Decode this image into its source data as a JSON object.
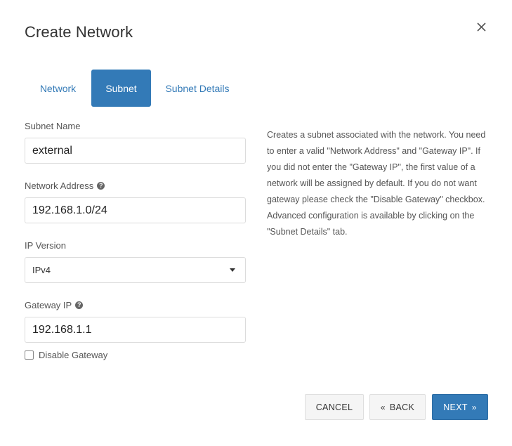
{
  "dialog": {
    "title": "Create Network"
  },
  "tabs": [
    {
      "label": "Network",
      "active": false
    },
    {
      "label": "Subnet",
      "active": true
    },
    {
      "label": "Subnet Details",
      "active": false
    }
  ],
  "form": {
    "subnet_name": {
      "label": "Subnet Name",
      "value": "external"
    },
    "network_address": {
      "label": "Network Address",
      "value": "192.168.1.0/24",
      "help": "?"
    },
    "ip_version": {
      "label": "IP Version",
      "selected": "IPv4"
    },
    "gateway_ip": {
      "label": "Gateway IP",
      "value": "192.168.1.1",
      "help": "?"
    },
    "disable_gateway": {
      "label": "Disable Gateway",
      "checked": false
    }
  },
  "help_text": "Creates a subnet associated with the network. You need to enter a valid \"Network Address\" and \"Gateway IP\". If you did not enter the \"Gateway IP\", the first value of a network will be assigned by default. If you do not want gateway please check the \"Disable Gateway\" checkbox. Advanced configuration is available by clicking on the \"Subnet Details\" tab.",
  "footer": {
    "cancel_label": "CANCEL",
    "back_label": "BACK",
    "back_glyph": "«",
    "next_label": "NEXT",
    "next_glyph": "»"
  },
  "colors": {
    "accent": "#337ab7",
    "button_bg": "#f5f5f5",
    "border": "#dcdcdc"
  }
}
